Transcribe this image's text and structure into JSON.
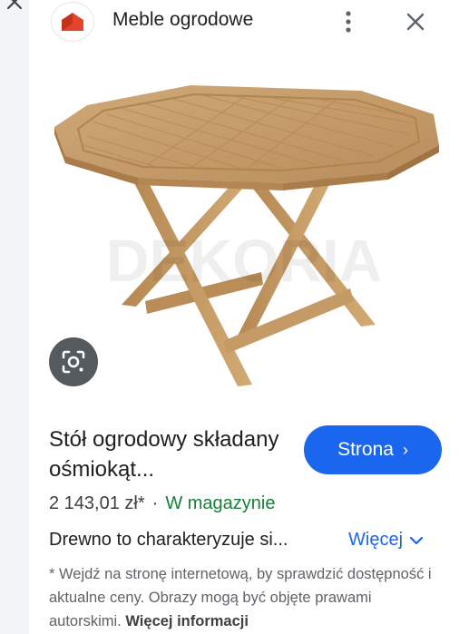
{
  "header": {
    "site_name": "Meble ogrodowe",
    "logo_icon": "brand-house-logo",
    "more_icon": "vertical-dots-icon",
    "close_icon": "close-icon"
  },
  "image": {
    "watermark": "DEKORIA",
    "lens_icon": "google-lens-icon"
  },
  "product": {
    "title": "Stół ogrodowy składany ośmiokąt...",
    "price": "2 143,01 zł*",
    "separator": "·",
    "stock": "W magazynie",
    "description": "Drewno to charakteryzuje si...",
    "more_label": "Więcej"
  },
  "visit_button": {
    "label": "Strona",
    "chevron": "›"
  },
  "disclaimer": {
    "text": "* Wejdź na stronę internetową, by sprawdzić dostępność i aktualne ceny. Obrazy mogą być objęte prawami autorskimi.",
    "link": "Więcej informacji"
  },
  "colors": {
    "accent": "#1b66ee",
    "stock_green": "#188038",
    "brand_red": "#e2442c"
  }
}
